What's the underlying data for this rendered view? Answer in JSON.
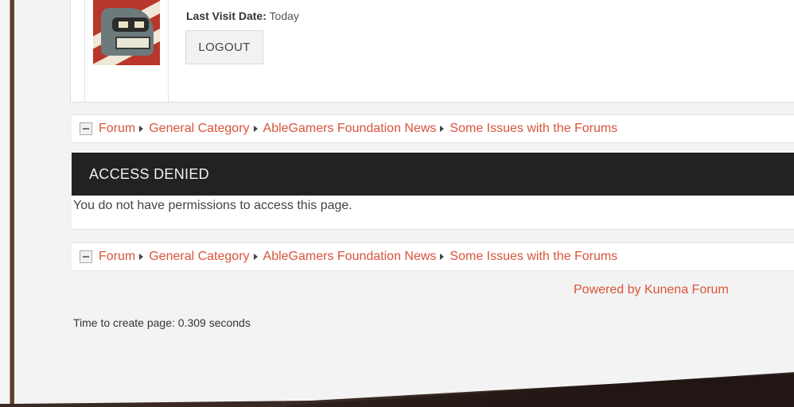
{
  "profile": {
    "last_visit_label": "Last Visit Date:",
    "last_visit_value": "Today",
    "logout_label": "LOGOUT"
  },
  "breadcrumb": {
    "items": [
      "Forum",
      "General Category",
      "AbleGamers Foundation News",
      "Some Issues with the Forums"
    ]
  },
  "access": {
    "title": "ACCESS DENIED",
    "message": "You do not have permissions to access this page."
  },
  "footer": {
    "powered_by": "Powered by Kunena Forum",
    "timing": "Time to create page: 0.309 seconds"
  },
  "colors": {
    "link": "#d9543a",
    "header_bg": "#222222"
  }
}
